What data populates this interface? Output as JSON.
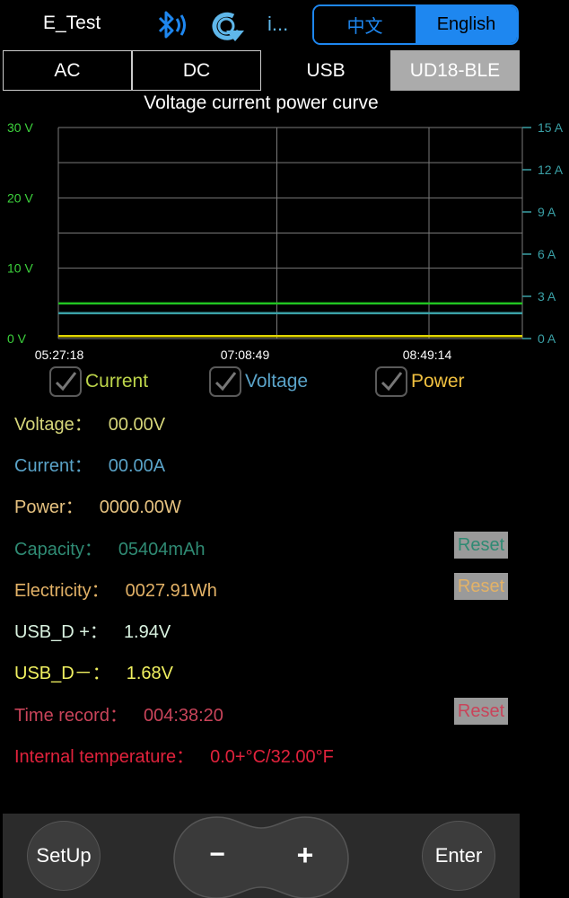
{
  "header": {
    "device_name": "E_Test",
    "bluetooth_icon": "bluetooth-icon",
    "refresh_icon": "refresh-icon",
    "info_text": "i...",
    "lang_cn": "中文",
    "lang_en": "English",
    "accent_color": "#1e87f0"
  },
  "tabs": [
    {
      "label": "AC"
    },
    {
      "label": "DC"
    },
    {
      "label": "USB"
    },
    {
      "label": "UD18-BLE",
      "selected": true
    }
  ],
  "chart_data": {
    "type": "line",
    "title": "Voltage current power curve",
    "x_ticks": [
      "05:27:18",
      "07:08:49",
      "08:49:14"
    ],
    "y_left": {
      "ticks": [
        "0 V",
        "10 V",
        "20 V",
        "30 V"
      ],
      "range": [
        0,
        30
      ],
      "color": "#3cd23c"
    },
    "y_right": {
      "ticks": [
        "0 A",
        "3 A",
        "6 A",
        "9 A",
        "12 A",
        "15 A"
      ],
      "range": [
        0,
        15
      ],
      "color": "#3aa0a6"
    },
    "grid": true,
    "series": [
      {
        "color": "#21c421",
        "values": [
          5.0,
          5.0
        ]
      },
      {
        "color": "#3aa0a6",
        "values": [
          3.6,
          3.6
        ]
      },
      {
        "color": "#e0d400",
        "values": [
          0.35,
          0.35
        ]
      }
    ]
  },
  "checkboxes": [
    {
      "label": "Current",
      "color": "#bdd54a",
      "checked": true
    },
    {
      "label": "Voltage",
      "color": "#5aa3c8",
      "checked": true
    },
    {
      "label": "Power",
      "color": "#f0c040",
      "checked": true
    }
  ],
  "readings": {
    "voltage": {
      "label": "Voltage：",
      "value": "00.00V",
      "color": "#d6d67a"
    },
    "current": {
      "label": "Current：",
      "value": "00.00A",
      "color": "#5aa3c8"
    },
    "power": {
      "label": "Power：",
      "value": "0000.00W",
      "color": "#e6c280"
    },
    "capacity": {
      "label": "Capacity：",
      "value": "05404mAh",
      "color": "#2f8a73",
      "reset": "Reset"
    },
    "electricity": {
      "label": "Electricity：",
      "value": "0027.91Wh",
      "color": "#e3b267",
      "reset": "Reset"
    },
    "usb_dp": {
      "label": "USB_D +：",
      "value": "1.94V",
      "color": "#d9f2e0"
    },
    "usb_dm": {
      "label": "USB_D－：",
      "value": "1.68V",
      "color": "#f0f060"
    },
    "time_record": {
      "label": "Time record：",
      "value": "004:38:20",
      "color": "#c9445a",
      "reset": "Reset"
    },
    "internal_temp": {
      "label": "Internal temperature：",
      "value": "0.0+°C/32.00°F",
      "color": "#e0223c"
    }
  },
  "bottom": {
    "setup": "SetUp",
    "minus": "−",
    "plus": "+",
    "enter": "Enter"
  }
}
